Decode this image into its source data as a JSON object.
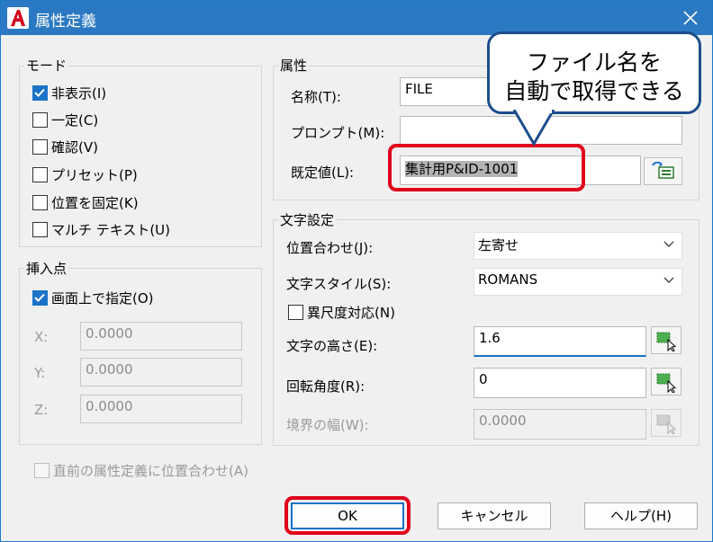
{
  "window": {
    "title": "属性定義"
  },
  "mode": {
    "legend": "モード",
    "options": [
      {
        "label": "非表示(I)",
        "checked": true
      },
      {
        "label": "一定(C)",
        "checked": false
      },
      {
        "label": "確認(V)",
        "checked": false
      },
      {
        "label": "プリセット(P)",
        "checked": false
      },
      {
        "label": "位置を固定(K)",
        "checked": false
      },
      {
        "label": "マルチ テキスト(U)",
        "checked": false
      }
    ]
  },
  "insertion": {
    "legend": "挿入点",
    "on_screen_label": "画面上で指定(O)",
    "x_label": "X:",
    "x_value": "0.0000",
    "y_label": "Y:",
    "y_value": "0.0000",
    "z_label": "Z:",
    "z_value": "0.0000"
  },
  "attribute": {
    "legend": "属性",
    "tag_label": "名称(T):",
    "tag_value": "FILE",
    "prompt_label": "プロンプト(M):",
    "prompt_value": "",
    "default_label": "既定値(L):",
    "default_value": "集計用P&ID-1001"
  },
  "text_settings": {
    "legend": "文字設定",
    "justify_label": "位置合わせ(J):",
    "justify_value": "左寄せ",
    "style_label": "文字スタイル(S):",
    "style_value": "ROMANS",
    "annotative_label": "異尺度対応(N)",
    "height_label": "文字の高さ(E):",
    "height_value": "1.6",
    "rotation_label": "回転角度(R):",
    "rotation_value": "0",
    "boundary_label": "境界の幅(W):",
    "boundary_value": "0.0000"
  },
  "align_below_label": "直前の属性定義に位置合わせ(A)",
  "buttons": {
    "ok": "OK",
    "cancel": "キャンセル",
    "help": "ヘルプ(H)"
  },
  "callout": {
    "line1": "ファイル名を",
    "line2": "自動で取得できる"
  },
  "colors": {
    "titlebar": "#2b79c2",
    "highlight": "#e0001b",
    "callout_border": "#1d4e8c",
    "accent": "#1a73c8"
  }
}
